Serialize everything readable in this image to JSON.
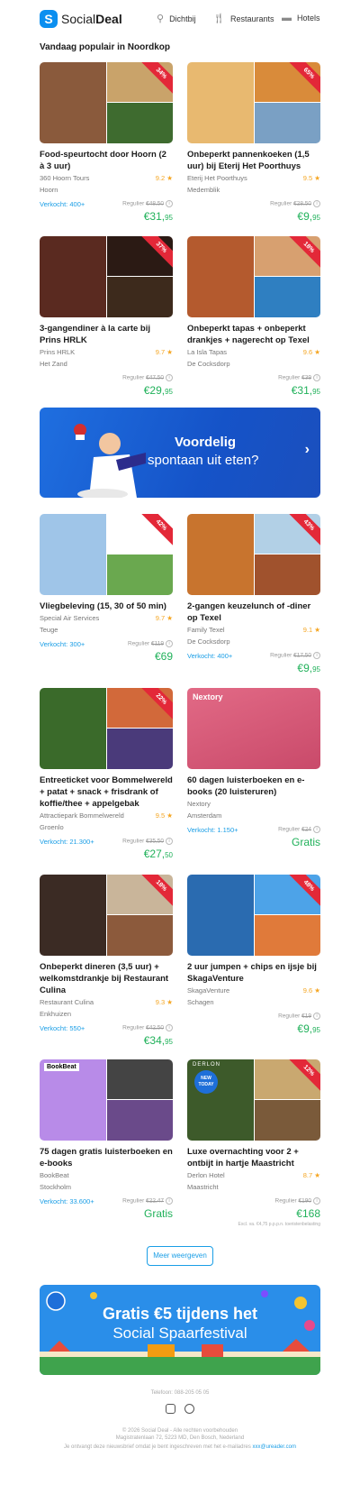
{
  "header": {
    "logo_text_1": "Social",
    "logo_text_2": "Deal",
    "nav": [
      {
        "label": "Dichtbij",
        "icon": "location-pin-icon"
      },
      {
        "label": "Restaurants",
        "icon": "fork-knife-icon"
      },
      {
        "label": "Hotels",
        "icon": "bed-icon"
      }
    ]
  },
  "section_title": "Vandaag populair in Noordkop",
  "deals": [
    {
      "title": "Food-speurtocht door Hoorn (2 à 3 uur)",
      "partner": "360 Hoorn Tours",
      "location": "Hoorn",
      "rating": "9.2 ★",
      "sold": "Verkocht: 400+",
      "regular_label": "Regulier",
      "regular_price": "€48,50",
      "price_main": "€31,",
      "price_cents": "95",
      "discount": "34%"
    },
    {
      "title": "Onbeperkt pannenkoeken (1,5 uur) bij Eterij Het Poorthuys",
      "partner": "Eterij Het Poorthuys",
      "location": "Medemblik",
      "rating": "9.5 ★",
      "sold": "",
      "regular_label": "Regulier",
      "regular_price": "€28,50",
      "price_main": "€9,",
      "price_cents": "95",
      "discount": "65%"
    },
    {
      "title": "3-gangendiner à la carte bij Prins HRLK",
      "partner": "Prins HRLK",
      "location": "Het Zand",
      "rating": "9.7 ★",
      "sold": "",
      "regular_label": "Regulier",
      "regular_price": "€47,50",
      "price_main": "€29,",
      "price_cents": "95",
      "discount": "37%"
    },
    {
      "title": "Onbeperkt tapas + onbeperkt drankjes + nagerecht op Texel",
      "partner": "La Isla Tapas",
      "location": "De Cocksdorp",
      "rating": "9.6 ★",
      "sold": "",
      "regular_label": "Regulier",
      "regular_price": "€39",
      "price_main": "€31,",
      "price_cents": "95",
      "discount": "18%"
    },
    {
      "title": "Vliegbeleving (15, 30 of 50 min)",
      "partner": "Special Air Services",
      "location": "Teuge",
      "rating": "9.7 ★",
      "sold": "Verkocht: 300+",
      "regular_label": "Regulier",
      "regular_price": "€119",
      "price_main": "€69",
      "price_cents": "",
      "discount": "42%"
    },
    {
      "title": "2-gangen keuzelunch of -diner op Texel",
      "partner": "Family Texel",
      "location": "De Cocksdorp",
      "rating": "9.1 ★",
      "sold": "Verkocht: 400+",
      "regular_label": "Regulier",
      "regular_price": "€17,50",
      "price_main": "€9,",
      "price_cents": "95",
      "discount": "43%"
    },
    {
      "title": "Entreeticket voor Bommelwereld + patat + snack + frisdrank of koffie/thee + appelgebak",
      "partner": "Attractiepark Bommelwereld",
      "location": "Groenlo",
      "rating": "9.5 ★",
      "sold": "Verkocht: 21.300+",
      "regular_label": "Regulier",
      "regular_price": "€35,50",
      "price_main": "€27,",
      "price_cents": "50",
      "discount": "22%"
    },
    {
      "title": "60 dagen luisterboeken en e-books (20 luisteruren)",
      "partner": "Nextory",
      "location": "Amsterdam",
      "rating": "",
      "sold": "Verkocht: 1.150+",
      "regular_label": "Regulier",
      "regular_price": "€24",
      "price_main": "Gratis",
      "price_cents": "",
      "discount": ""
    },
    {
      "title": "Onbeperkt dineren (3,5 uur) + welkomstdrankje bij Restaurant Culina",
      "partner": "Restaurant Culina",
      "location": "Enkhuizen",
      "rating": "9.3 ★",
      "sold": "Verkocht: 550+",
      "regular_label": "Regulier",
      "regular_price": "€42,50",
      "price_main": "€34,",
      "price_cents": "95",
      "discount": "18%"
    },
    {
      "title": "2 uur jumpen + chips en ijsje bij SkagaVenture",
      "partner": "SkagaVenture",
      "location": "Schagen",
      "rating": "9.6 ★",
      "sold": "",
      "regular_label": "Regulier",
      "regular_price": "€19",
      "price_main": "€9,",
      "price_cents": "95",
      "discount": "48%"
    },
    {
      "title": "75 dagen gratis luisterboeken en e-books",
      "partner": "BookBeat",
      "location": "Stockholm",
      "rating": "",
      "sold": "Verkocht: 33.600+",
      "regular_label": "Regulier",
      "regular_price": "€22,47",
      "price_main": "Gratis",
      "price_cents": "",
      "discount": ""
    },
    {
      "title": "Luxe overnachting voor 2 + ontbijt in hartje Maastricht",
      "partner": "Derlon Hotel",
      "location": "Maastricht",
      "rating": "8.7 ★",
      "sold": "",
      "regular_label": "Regulier",
      "regular_price": "€190",
      "price_main": "€168",
      "price_cents": "",
      "discount": "12%"
    }
  ],
  "image_labels": {
    "nextory": "Nextory",
    "bookbeat": "BookBeat",
    "derlon": "DERLON",
    "new_today": "NEW TODAY"
  },
  "banner1": {
    "title": "Voordelig",
    "subtitle": "spontaan uit eten?"
  },
  "banner2": {
    "title": "Gratis €5 tijdens het",
    "subtitle": "Social Spaarfestival"
  },
  "fineprint": "Excl. va. €4,75 p.p.p.n. toeristenbelasting",
  "more_button": "Meer weergeven",
  "footer": {
    "phone": "Telefoon: 088-205 05 05",
    "copyright": "© 2026 Social Deal - Alle rechten voorbehouden",
    "address": "Magistratenlaan 72, 5223 MD, Den Bosch, Nederland",
    "note": "Je ontvangt deze nieuwsbrief omdat je bent ingeschreven met het e-mailadres",
    "email": "xxx@ureader.com"
  },
  "colors": {
    "brand": "#0b8ff0",
    "price_green": "#20b15a",
    "sold_blue": "#1a9ee6",
    "discount_red": "#e32838",
    "rating_orange": "#f5a623"
  }
}
